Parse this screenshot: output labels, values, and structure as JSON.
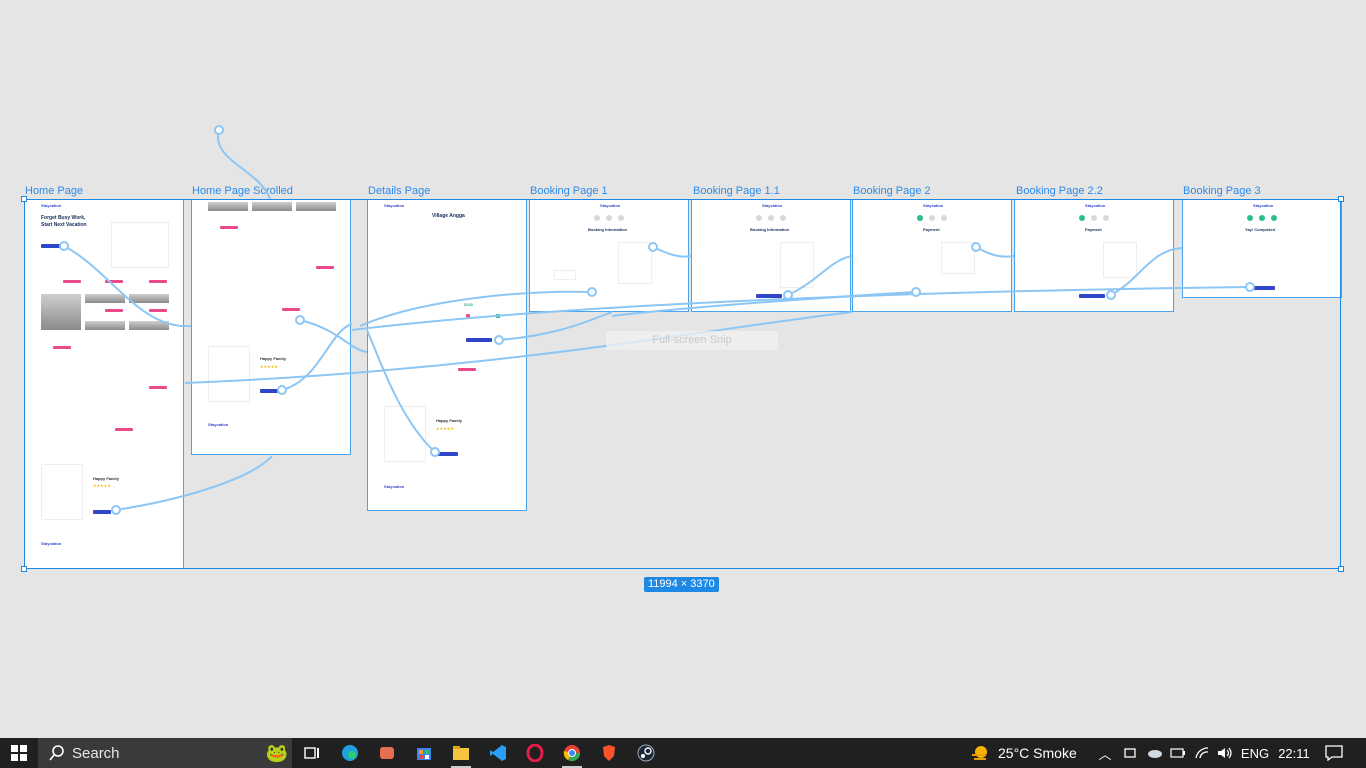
{
  "canvas": {
    "frames": [
      {
        "label": "Home Page"
      },
      {
        "label": "Home Page Scrolled"
      },
      {
        "label": "Details Page"
      },
      {
        "label": "Booking Page 1"
      },
      {
        "label": "Booking Page 1.1"
      },
      {
        "label": "Booking Page 2"
      },
      {
        "label": "Booking Page 2.2"
      },
      {
        "label": "Booking Page 3"
      }
    ],
    "selection_size": "11994 × 3370",
    "snip_hint": "Full-screen Snip",
    "mini": {
      "home_headline_1": "Forget Busy Work,",
      "home_headline_2": "Start Next Vacation",
      "brand": "Staycation",
      "details_title": "Village Angga",
      "booking_info": "Booking Information",
      "payment": "Payment",
      "completed": "Yay! Completed",
      "happy_family": "Happy Family",
      "stars": "★★★★★",
      "price": "$280",
      "testimonial": "What a great trip with my family and I should try again next time soon ...",
      "testimonial_details": "As a wife can pick a great trip with my own lovely family ... thank you!"
    },
    "selection_color": "#1e88e5",
    "accent_pink": "#e94b8a",
    "accent_blue": "#2f46c9",
    "success_green": "#2bbd8a"
  },
  "taskbar": {
    "search_placeholder": "Search",
    "weather": "25°C  Smoke",
    "language": "ENG",
    "time": "22:11",
    "apps": [
      "task-view-icon",
      "edge-icon",
      "app-icon",
      "store-icon",
      "file-explorer-icon",
      "vscode-icon",
      "opera-icon",
      "chrome-icon",
      "brave-icon",
      "steam-icon"
    ]
  }
}
